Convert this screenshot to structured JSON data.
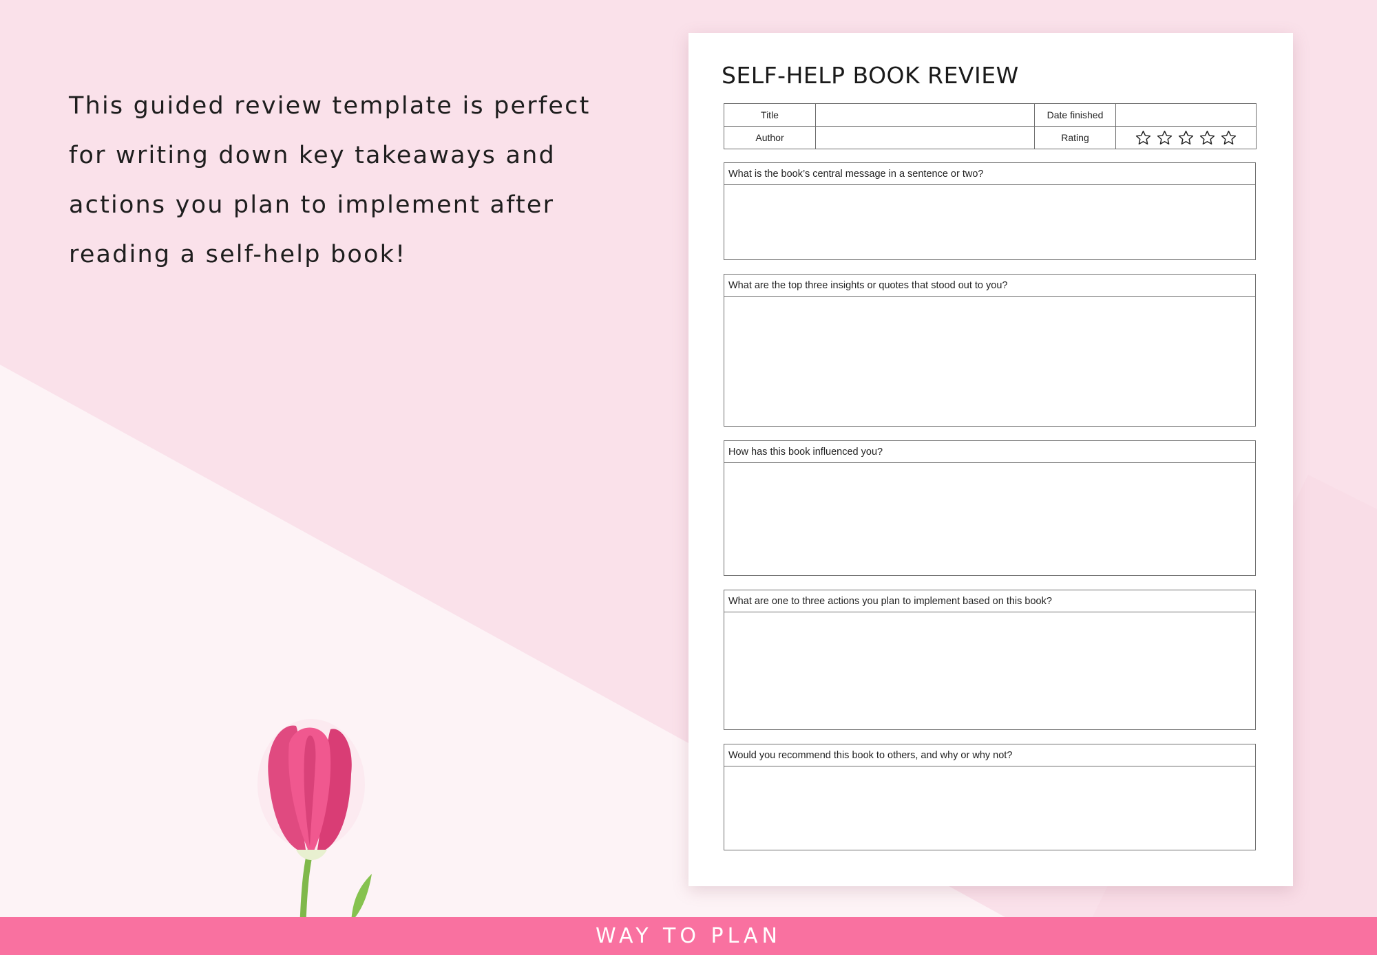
{
  "promo_text": "This guided review template is perfect for writing down key takeaways and actions you plan to implement after reading a self-help book!",
  "document": {
    "title": "SELF-HELP BOOK REVIEW",
    "fields": {
      "title_label": "Title",
      "author_label": "Author",
      "date_label": "Date finished",
      "rating_label": "Rating"
    },
    "rating": {
      "stars_total": 5,
      "stars_filled": 0,
      "icon": "star-outline-icon"
    },
    "questions": [
      "What is the book’s central message in a sentence or two?",
      "What are the top three insights or quotes that stood out to you?",
      "How has this book influenced you?",
      "What are one to three actions you plan to implement based on this book?",
      "Would you recommend this book to others, and why or why not?"
    ]
  },
  "decor": {
    "image": "pink-tulip-icon"
  },
  "footer": {
    "brand": "WAY TO PLAN"
  },
  "colors": {
    "accent": "#f971a0",
    "background": "#fdf3f6",
    "band": "#fae1ea",
    "tulip": "#e6497f"
  }
}
